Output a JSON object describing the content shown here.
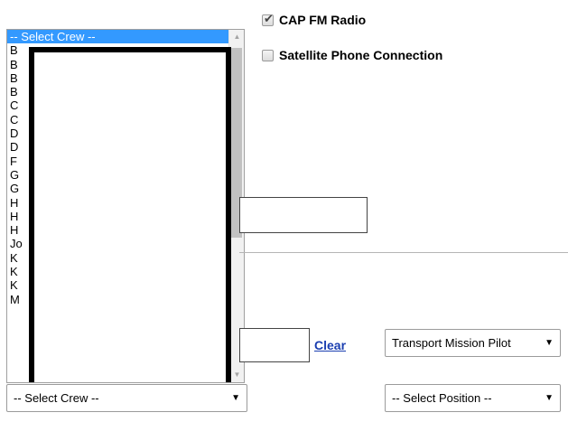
{
  "checkboxes": [
    {
      "label": "CAP FM Radio",
      "checked": true
    },
    {
      "label": "Satellite Phone Connection",
      "checked": false
    }
  ],
  "crew_list": {
    "selected": "-- Select Crew --",
    "partial_items": [
      "B",
      "B",
      "B",
      "B",
      "C",
      "C",
      "D",
      "D",
      "F",
      "G",
      "G",
      "H",
      "H",
      "H",
      "Jo",
      "K",
      "K",
      "K",
      "M"
    ]
  },
  "crew_select": {
    "value": "-- Select Crew --"
  },
  "clear_link": "Clear",
  "position_selects": [
    {
      "value": "Transport Mission Pilot"
    },
    {
      "value": "-- Select Position --"
    }
  ],
  "colors": {
    "selection": "#3399ff",
    "link": "#1a3eb0"
  },
  "icons": {
    "check": "checkmark-icon",
    "caret": "chevron-down-icon",
    "scroll_up": "scroll-up-arrow-icon",
    "scroll_down": "scroll-down-arrow-icon"
  }
}
